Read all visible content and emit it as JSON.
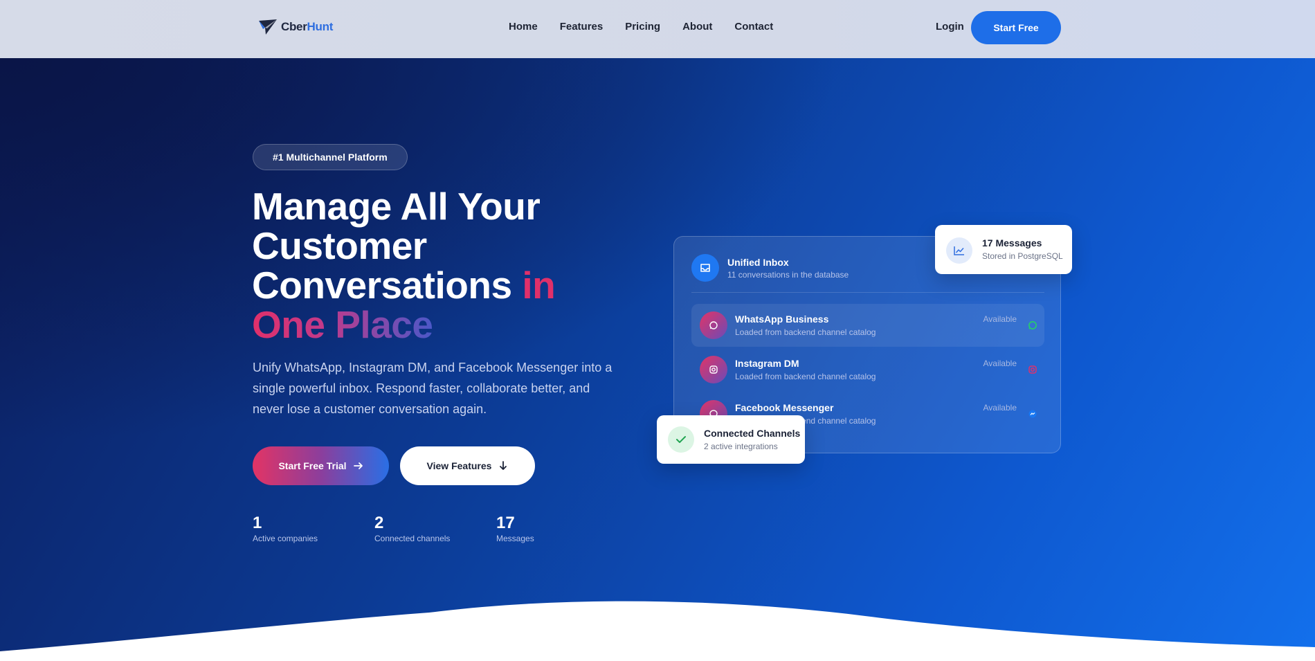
{
  "brand": {
    "name_a": "Cber",
    "name_b": "Hunt"
  },
  "nav": {
    "links": [
      "Home",
      "Features",
      "Pricing",
      "About",
      "Contact"
    ],
    "login": "Login",
    "cta": "Start Free"
  },
  "hero": {
    "badge": "#1 Multichannel Platform",
    "headline_line1": "Manage All Your",
    "headline_line2": "Customer",
    "headline_line3": "Conversations",
    "headline_in": "in",
    "headline_line4": "One Place",
    "subtext": "Unify WhatsApp, Instagram DM, and Facebook Messenger into a single powerful inbox. Respond faster, collaborate better, and never lose a customer conversation again.",
    "primary_cta": "Start Free Trial",
    "secondary_cta": "View Features",
    "stats": [
      {
        "value": "1",
        "label": "Active companies"
      },
      {
        "value": "2",
        "label": "Connected channels"
      },
      {
        "value": "17",
        "label": "Messages"
      }
    ]
  },
  "inbox": {
    "title": "Unified Inbox",
    "subtitle": "11 conversations in the database",
    "channels": [
      {
        "name": "WhatsApp Business",
        "desc": "Loaded from backend channel catalog",
        "status": "Available",
        "icon": "whatsapp-icon",
        "color": "#25d366"
      },
      {
        "name": "Instagram DM",
        "desc": "Loaded from backend channel catalog",
        "status": "Available",
        "icon": "instagram-icon",
        "color": "#e1306c"
      },
      {
        "name": "Facebook Messenger",
        "desc": "Loaded from backend channel catalog",
        "status": "Available",
        "icon": "messenger-icon",
        "color": "#1877f2"
      }
    ]
  },
  "messages_card": {
    "title": "17 Messages",
    "subtitle": "Stored in PostgreSQL"
  },
  "connected_card": {
    "title": "Connected Channels",
    "subtitle": "2 active integrations"
  },
  "colors": {
    "primary": "#1e6ee8",
    "accent_pink": "#e0306a",
    "hero_dark": "#0c1d5c"
  }
}
